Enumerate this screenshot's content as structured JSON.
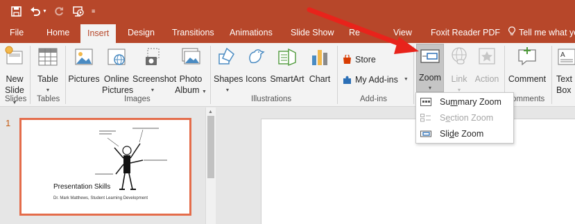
{
  "quick_access": {
    "icons": [
      "save-icon",
      "undo-icon",
      "redo-icon",
      "start-from-beginning-icon",
      "customize-qat-icon"
    ]
  },
  "tabs": [
    {
      "label": "File",
      "active": false
    },
    {
      "label": "Home",
      "active": false
    },
    {
      "label": "Insert",
      "active": true
    },
    {
      "label": "Design",
      "active": false
    },
    {
      "label": "Transitions",
      "active": false
    },
    {
      "label": "Animations",
      "active": false
    },
    {
      "label": "Slide Show",
      "active": false
    },
    {
      "label": "Re",
      "active": false
    },
    {
      "label": "View",
      "active": false
    },
    {
      "label": "Foxit Reader PDF",
      "active": false
    }
  ],
  "tell_me": "Tell me what you",
  "ribbon": {
    "new_slide": {
      "line1": "New",
      "line2": "Slide"
    },
    "table": "Table",
    "pictures": "Pictures",
    "online_pictures": {
      "line1": "Online",
      "line2": "Pictures"
    },
    "screenshot": "Screenshot",
    "photo_album": {
      "line1": "Photo",
      "line2": "Album"
    },
    "shapes": "Shapes",
    "icons": "Icons",
    "smartart": "SmartArt",
    "chart": "Chart",
    "store": "Store",
    "my_addins": "My Add-ins",
    "zoom": "Zoom",
    "link": "Link",
    "action": "Action",
    "comment": "Comment",
    "textbox": {
      "line1": "Text",
      "line2": "Box"
    },
    "groups": {
      "slides": "Slides",
      "tables": "Tables",
      "images": "Images",
      "illustrations": "Illustrations",
      "addins": "Add-ins",
      "comments": "omments"
    }
  },
  "zoom_menu": {
    "summary_zoom": {
      "before": "Su",
      "underline": "m",
      "after": "mary Zoom",
      "enabled": true
    },
    "section_zoom": {
      "before": "S",
      "underline": "e",
      "after": "ction Zoom",
      "enabled": false
    },
    "slide_zoom": {
      "before": "Sli",
      "underline": "d",
      "after": "e Zoom",
      "enabled": true
    }
  },
  "slide_panel": {
    "slide_number": "1",
    "title": "Presentation Skills",
    "subtitle": "Dr. Mark Matthews, Student Learning Development"
  },
  "colors": {
    "brand": "#b7472a",
    "ribbon_bg": "#f3f3f3",
    "selected_outline": "#e46c4a",
    "arrow": "#e8231b"
  }
}
